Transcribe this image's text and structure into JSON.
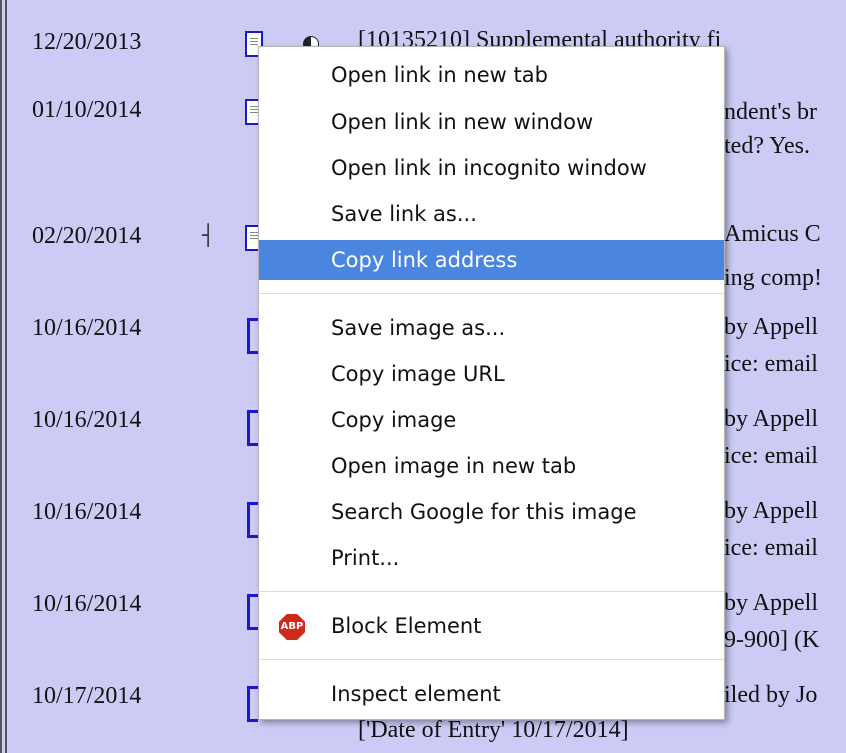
{
  "docket": {
    "rows": [
      {
        "date": "12/20/2013",
        "text1": "[10135210] Supplemental authority fi"
      },
      {
        "date": "01/10/2014",
        "text1": "ndent's br",
        "text2": "ted? Yes."
      },
      {
        "date": "02/20/2014",
        "text1": "Amicus C",
        "text2": "ing comp!"
      },
      {
        "date": "10/16/2014",
        "text1": "by Appell",
        "text2": "ice: email"
      },
      {
        "date": "10/16/2014",
        "text1": "by Appell",
        "text2": "ice: email"
      },
      {
        "date": "10/16/2014",
        "text1": "by Appell",
        "text2": "ice: email"
      },
      {
        "date": "10/16/2014",
        "text1": "by Appell",
        "text2": "9-900] (K"
      },
      {
        "date": "10/17/2014",
        "text1": "iled by Jo",
        "text2": "['Date of Entry' 10/17/2014]"
      }
    ]
  },
  "context_menu": {
    "items": [
      {
        "label": "Open link in new tab"
      },
      {
        "label": "Open link in new window"
      },
      {
        "label": "Open link in incognito window"
      },
      {
        "label": "Save link as..."
      },
      {
        "label": "Copy link address",
        "highlighted": true
      },
      {
        "label": "Save image as..."
      },
      {
        "label": "Copy image URL"
      },
      {
        "label": "Copy image"
      },
      {
        "label": "Open image in new tab"
      },
      {
        "label": "Search Google for this image"
      },
      {
        "label": "Print..."
      },
      {
        "label": "Block Element",
        "icon": "abp-icon",
        "icon_text": "ABP"
      },
      {
        "label": "Inspect element"
      }
    ]
  },
  "colors": {
    "page_background": "#cccbf6",
    "highlight": "#4a86e0",
    "link_blue": "#1919cc",
    "abp_red": "#cc2a1a"
  }
}
